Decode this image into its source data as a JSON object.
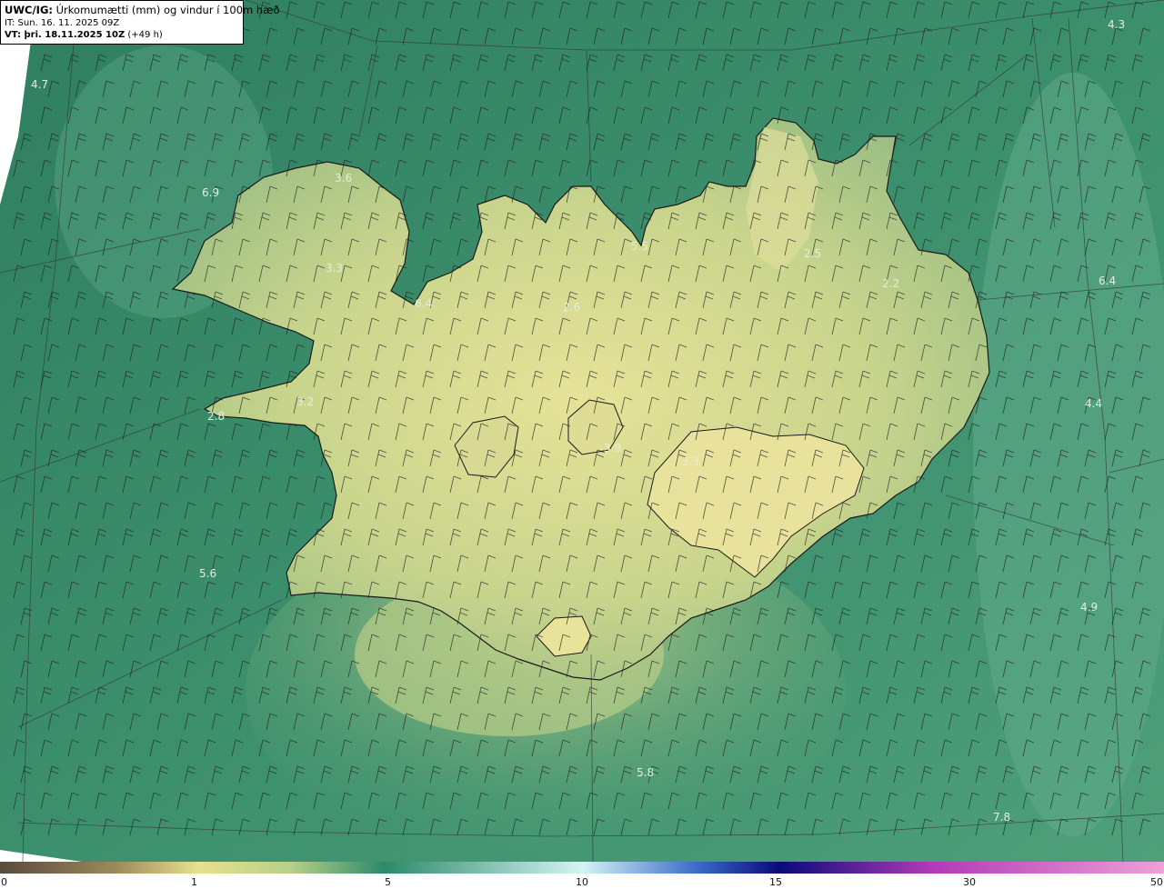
{
  "header": {
    "model_label": "UWC/IG:",
    "field_title": "Úrkomumætti (mm) og vindur í 100m hæð",
    "init_time": "IT: Sun. 16. 11. 2025 09Z",
    "valid_label": "VT: þri. 18.11.2025 10Z",
    "lead_time": "(+49 h)"
  },
  "value_labels": [
    "4.3",
    "4.7",
    "3.6",
    "6.9",
    "5.5",
    "2.5",
    "3.3",
    "6.4",
    "2.2",
    "2.6",
    "6.4",
    "3.2",
    "2.8",
    "4.4",
    "3.9",
    "3.3",
    "5.6",
    "4.9",
    "5.8",
    "7.8"
  ],
  "colorbar": {
    "tick_labels": [
      "0",
      "1",
      "5",
      "10",
      "15",
      "30",
      "50"
    ],
    "stops": [
      {
        "v": 0,
        "color": "#5a4a3c"
      },
      {
        "v": 0.1,
        "color": "#9c8a5e"
      },
      {
        "v": 0.17,
        "color": "#e8e08a"
      },
      {
        "v": 0.25,
        "color": "#b7cf88"
      },
      {
        "v": 0.33,
        "color": "#2c8a6a"
      },
      {
        "v": 0.5,
        "color": "#d4f4f4"
      },
      {
        "v": 0.6,
        "color": "#3a6ac8"
      },
      {
        "v": 0.67,
        "color": "#0a0a78"
      },
      {
        "v": 0.8,
        "color": "#b03ab8"
      },
      {
        "v": 1.0,
        "color": "#f0a0d8"
      }
    ]
  },
  "colors": {
    "sea": "#3d8f6e",
    "sea_dark": "#2f7a5c",
    "land": "#c5d28c",
    "land_high": "#e2e195",
    "coast": "#1a1a1a",
    "barb": "#222222",
    "label": "#e4ece4"
  }
}
